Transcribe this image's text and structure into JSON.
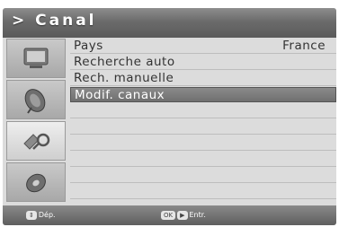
{
  "header": {
    "title": "> Canal"
  },
  "sidebar": {
    "tabs": [
      {
        "icon": "tv-icon",
        "active": false
      },
      {
        "icon": "satellite-dish-icon",
        "active": false
      },
      {
        "icon": "magnifier-icon",
        "active": true
      },
      {
        "icon": "disc-icon",
        "active": false
      }
    ]
  },
  "menu": {
    "items": [
      {
        "label": "Pays",
        "value": "France"
      },
      {
        "label": "Recherche auto"
      },
      {
        "label": "Rech. manuelle"
      },
      {
        "label": "Modif. canaux",
        "selected": true
      }
    ]
  },
  "footer": {
    "move_key": "⇕",
    "move_label": "Dép.",
    "ok_key": "OK",
    "enter_key": "▶",
    "enter_label": "Entr."
  }
}
